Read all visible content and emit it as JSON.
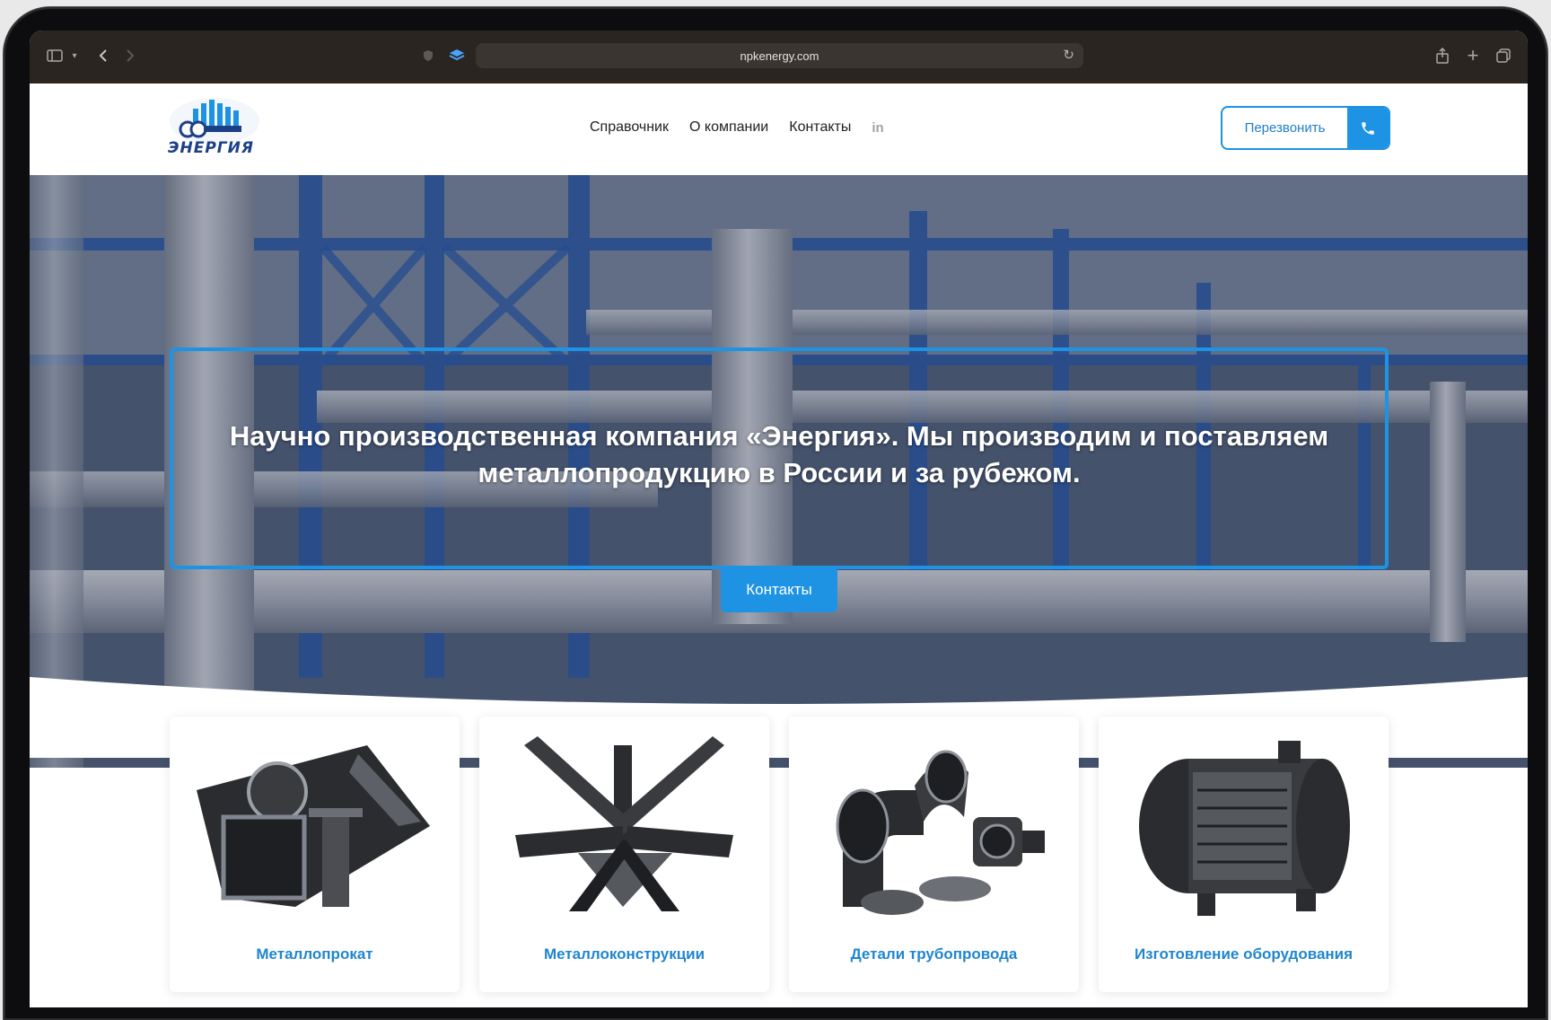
{
  "browser": {
    "url": "npkenergy.com"
  },
  "header": {
    "logo_text": "ЭНЕРГИЯ",
    "nav": [
      {
        "label": "Справочник"
      },
      {
        "label": "О компании"
      },
      {
        "label": "Контакты"
      },
      {
        "label": "in"
      }
    ],
    "callback_label": "Перезвонить"
  },
  "hero": {
    "title": "Научно производственная компания «Энергия». Мы производим и поставляем металлопродукцию в России и за рубежом.",
    "button_label": "Контакты"
  },
  "cards": [
    {
      "label": "Металлопрокат",
      "icon": "rolled-metal-icon"
    },
    {
      "label": "Металлоконструкции",
      "icon": "metal-structure-icon"
    },
    {
      "label": "Детали трубопровода",
      "icon": "pipe-fittings-icon"
    },
    {
      "label": "Изготовление оборудования",
      "icon": "heat-exchanger-icon"
    }
  ],
  "colors": {
    "accent": "#1e93e4",
    "card_label": "#1f86cf",
    "toolbar": "#2a2521"
  }
}
